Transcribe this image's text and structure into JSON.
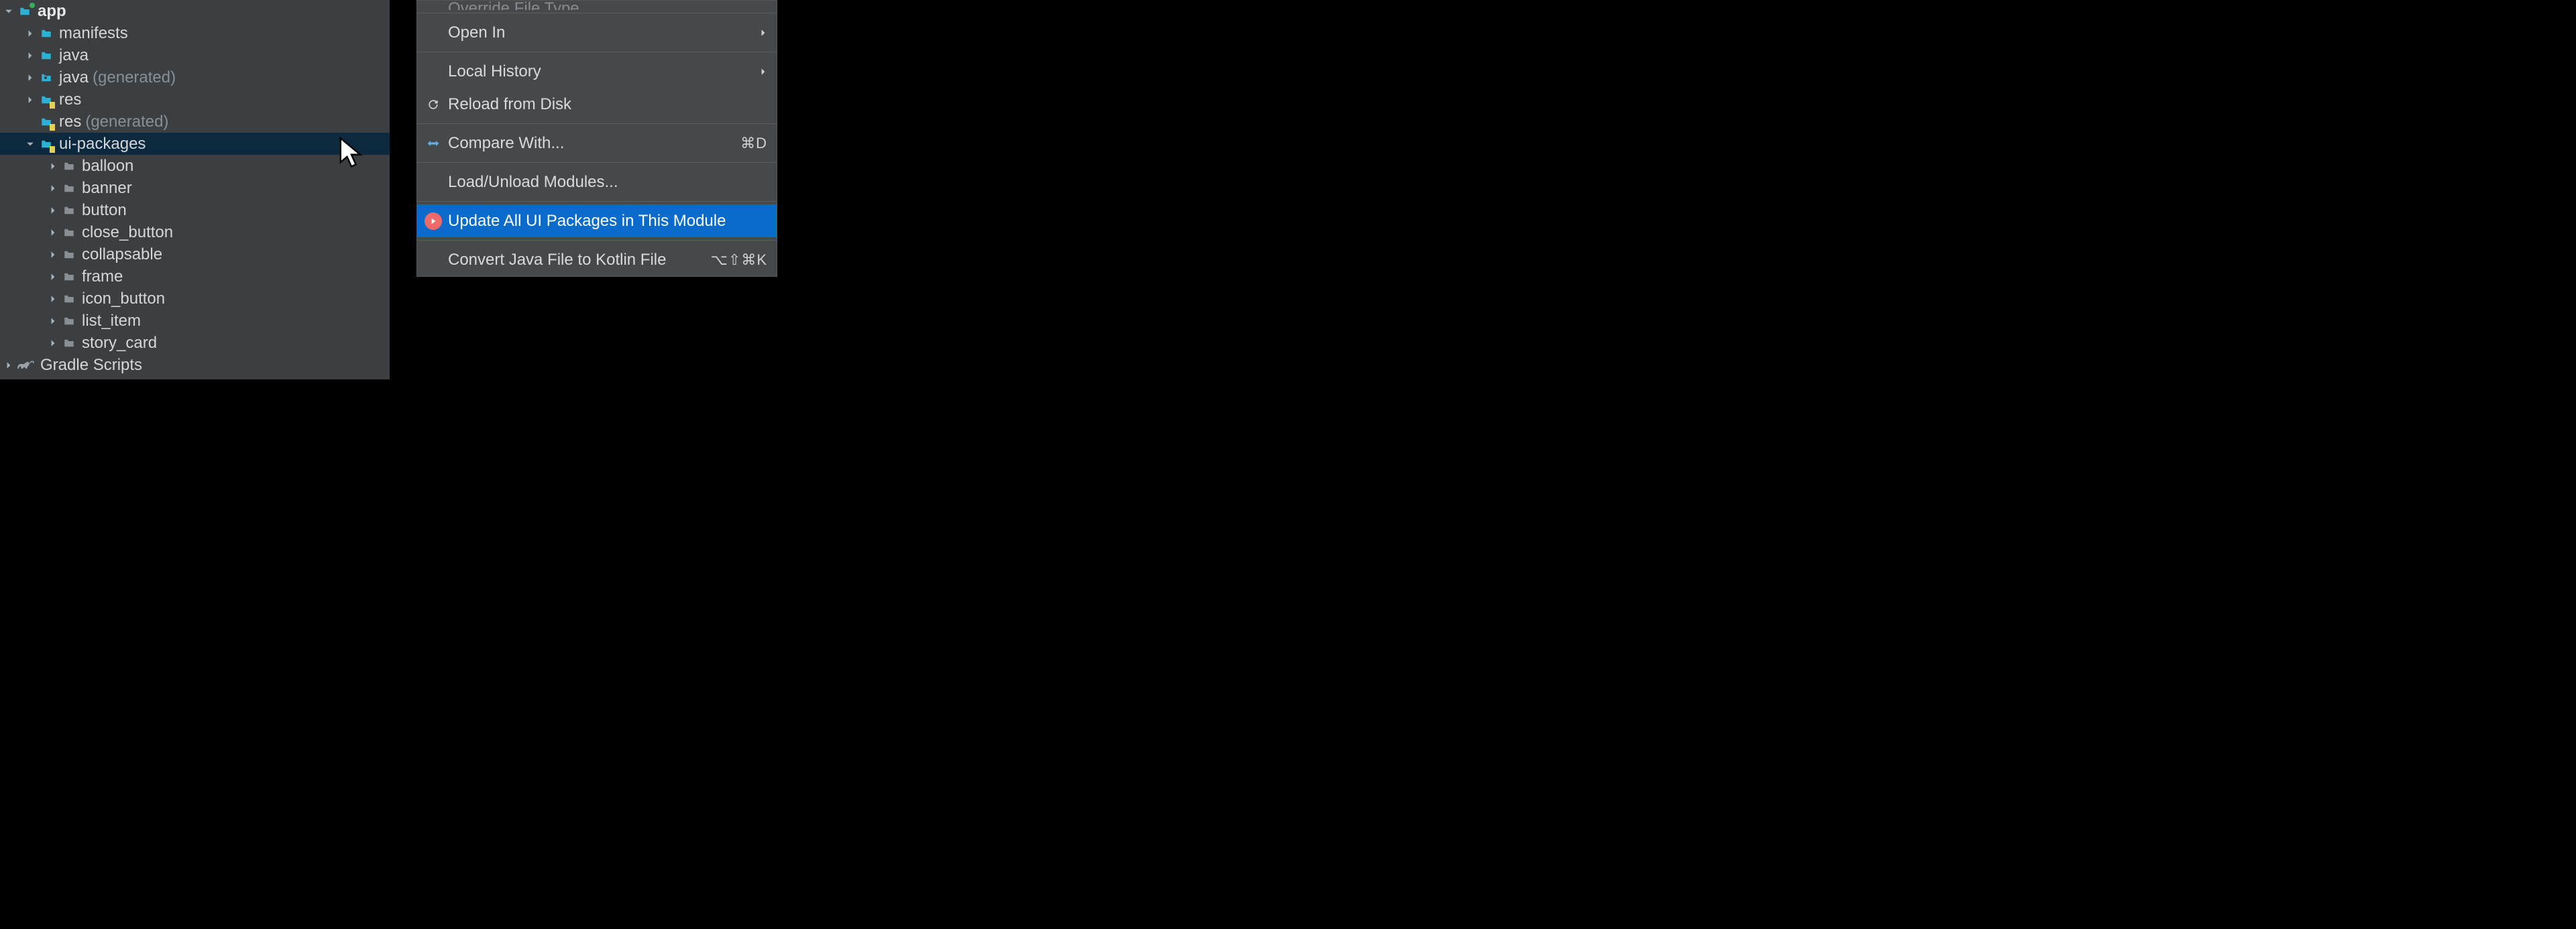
{
  "tree": {
    "app": {
      "label": "app",
      "children": {
        "manifests": "manifests",
        "java": "java",
        "java_gen": {
          "label": "java",
          "suffix": "(generated)"
        },
        "res": "res",
        "res_gen": {
          "label": "res",
          "suffix": "(generated)"
        },
        "ui_packages": {
          "label": "ui-packages",
          "children": [
            "balloon",
            "banner",
            "button",
            "close_button",
            "collapsable",
            "frame",
            "icon_button",
            "list_item",
            "story_card"
          ]
        }
      }
    },
    "gradle": "Gradle Scripts"
  },
  "menu": {
    "override_file_type": "Override File Type",
    "open_in": "Open In",
    "local_history": "Local History",
    "reload_from_disk": "Reload from Disk",
    "compare_with": "Compare With...",
    "compare_with_shortcut": "⌘D",
    "load_unload": "Load/Unload Modules...",
    "update_ui_packages": "Update All UI Packages in This Module",
    "convert_kotlin": "Convert Java File to Kotlin File",
    "convert_kotlin_shortcut": "⌥⇧⌘K"
  }
}
